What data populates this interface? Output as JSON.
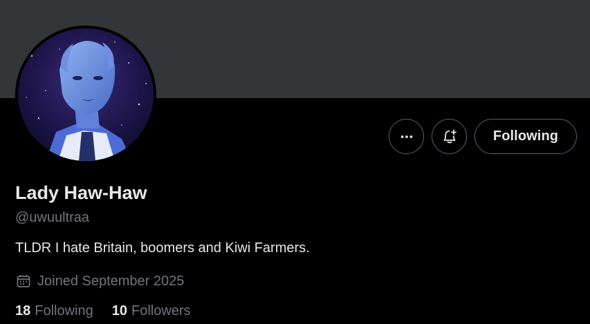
{
  "profile": {
    "display_name": "Lady Haw-Haw",
    "handle": "@uwuultraa",
    "bio": "TLDR I hate Britain, boomers and Kiwi Farmers.",
    "joined": "Joined September 2025"
  },
  "actions": {
    "more_icon": "more-horizontal-icon",
    "notify_icon": "bell-plus-icon",
    "follow_label": "Following"
  },
  "stats": {
    "following_count": "18",
    "following_label": "Following",
    "followers_count": "10",
    "followers_label": "Followers"
  },
  "colors": {
    "background": "#000000",
    "banner": "#333639",
    "primary_text": "#e7e9ea",
    "secondary_text": "#71767b",
    "button_border": "#536471"
  }
}
